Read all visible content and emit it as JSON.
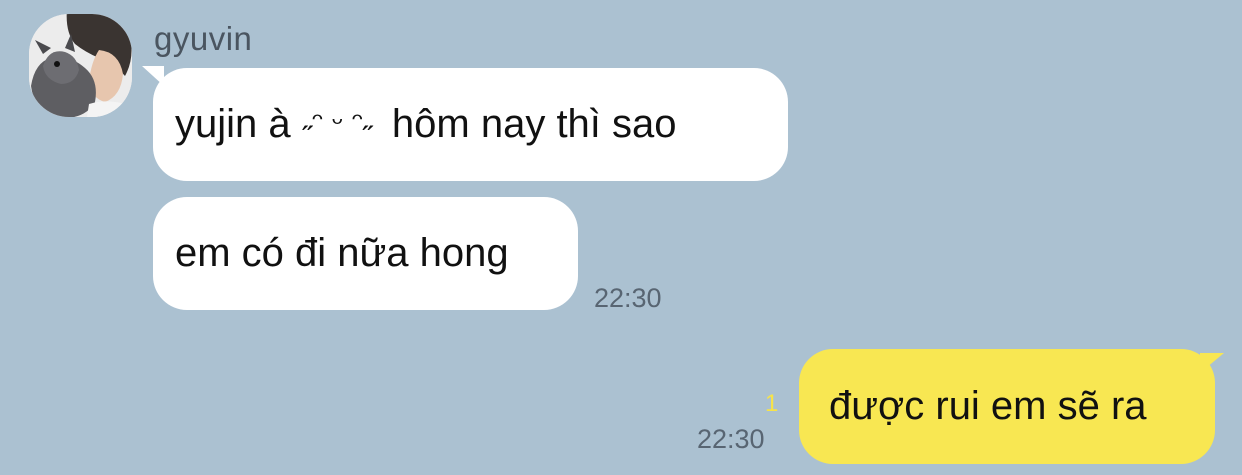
{
  "chat": {
    "sender": {
      "name": "gyuvin"
    },
    "incoming": [
      {
        "text": "yujin à",
        "decoration": "˶ᵔ ᵕ ᵔ˶",
        "text_after": "hôm nay thì sao"
      },
      {
        "text": "em có đi nữa hong"
      }
    ],
    "incoming_time": "22:30",
    "outgoing": {
      "text": "được rui em sẽ ra",
      "unread_count": "1",
      "time": "22:30"
    }
  },
  "colors": {
    "background": "#abc1d1",
    "incoming_bubble": "#ffffff",
    "outgoing_bubble": "#f8e752",
    "unread_count": "#f7e349",
    "timestamp": "#586572"
  }
}
